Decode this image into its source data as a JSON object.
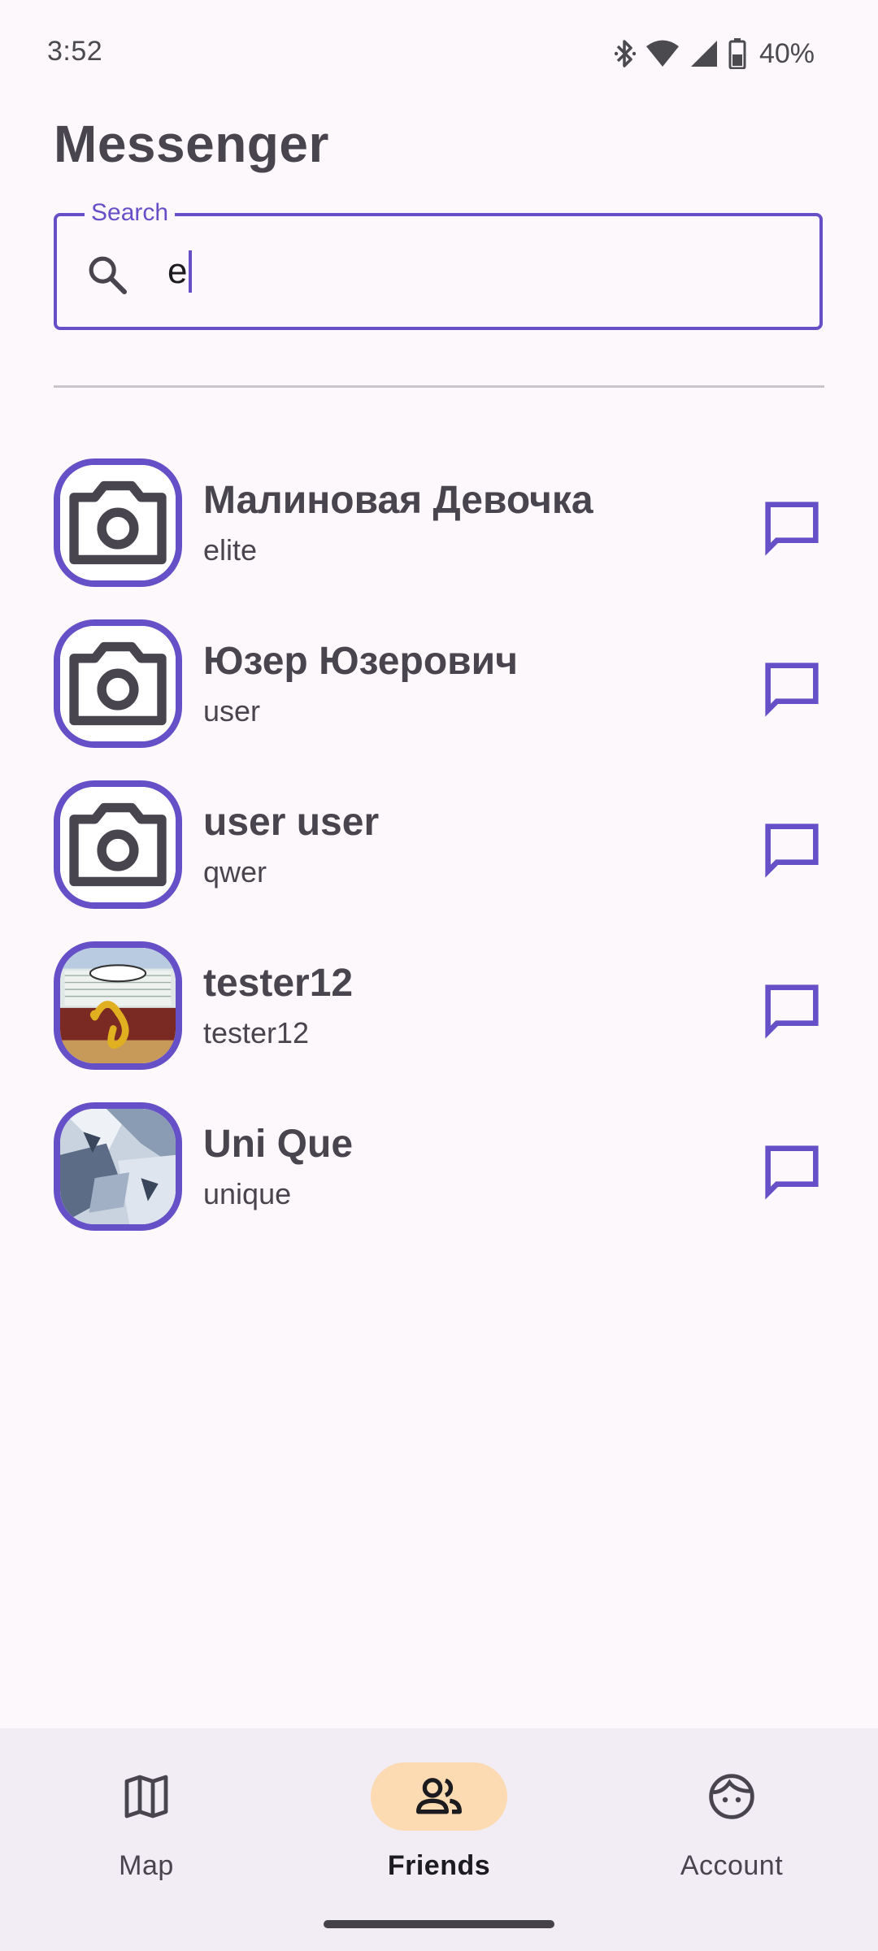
{
  "status_bar": {
    "time": "3:52",
    "battery_percent": "40%",
    "icons": [
      "bluetooth-icon",
      "wifi-icon",
      "cellular-signal-icon",
      "battery-icon"
    ]
  },
  "header": {
    "title": "Messenger"
  },
  "search": {
    "label": "Search",
    "value": "e",
    "icon": "search-icon"
  },
  "contacts": [
    {
      "name": "Малиновая Девочка",
      "username": "elite",
      "avatar": "camera-placeholder-icon"
    },
    {
      "name": "Юзер Юзерович",
      "username": "user",
      "avatar": "camera-placeholder-icon"
    },
    {
      "name": "user user",
      "username": "qwer",
      "avatar": "camera-placeholder-icon"
    },
    {
      "name": "tester12",
      "username": "tester12",
      "avatar": "photo"
    },
    {
      "name": "Uni Que",
      "username": "unique",
      "avatar": "photo"
    }
  ],
  "bottom_nav": {
    "active": "Friends",
    "items": [
      {
        "label": "Map",
        "icon": "map-icon"
      },
      {
        "label": "Friends",
        "icon": "people-icon"
      },
      {
        "label": "Account",
        "icon": "face-icon"
      }
    ]
  },
  "colors": {
    "accent": "#6650c8",
    "background": "#fdf8fc",
    "nav_background": "#f2edf5",
    "active_pill": "#fddbb2",
    "text": "#48454e"
  }
}
